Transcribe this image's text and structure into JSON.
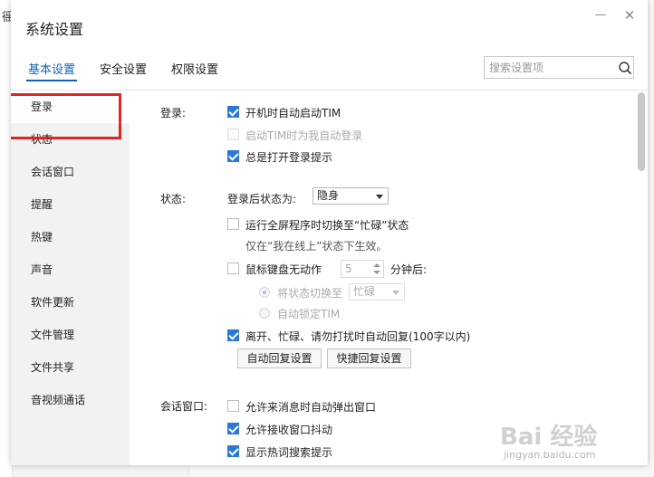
{
  "background": {
    "partial_char": "徭"
  },
  "window": {
    "title": "系统设置",
    "minimize": "—",
    "close": "✕"
  },
  "tabs": [
    {
      "label": "基本设置",
      "active": true
    },
    {
      "label": "安全设置",
      "active": false
    },
    {
      "label": "权限设置",
      "active": false
    }
  ],
  "search": {
    "placeholder": "搜索设置项",
    "value": ""
  },
  "sidebar": {
    "items": [
      {
        "label": "登录",
        "active": true
      },
      {
        "label": "状态",
        "active": false
      },
      {
        "label": "会话窗口",
        "active": false
      },
      {
        "label": "提醒",
        "active": false,
        "highlighted": true
      },
      {
        "label": "热键",
        "active": false
      },
      {
        "label": "声音",
        "active": false
      },
      {
        "label": "软件更新",
        "active": false
      },
      {
        "label": "文件管理",
        "active": false
      },
      {
        "label": "文件共享",
        "active": false
      },
      {
        "label": "音视频通话",
        "active": false
      }
    ]
  },
  "login": {
    "label": "登录:",
    "options": [
      {
        "text": "开机时自动启动TIM",
        "checked": true,
        "disabled": false
      },
      {
        "text": "启动TIM时为我自动登录",
        "checked": false,
        "disabled": true
      },
      {
        "text": "总是打开登录提示",
        "checked": true,
        "disabled": false
      }
    ]
  },
  "status": {
    "label": "状态:",
    "after_login_label": "登录后状态为:",
    "after_login_value": "隐身",
    "fullscreen_option": "运行全屏程序时切换至“忙碌”状态",
    "fullscreen_checked": false,
    "fullscreen_note": "仅在“我在线上”状态下生效。",
    "idle_option": "鼠标键盘无动作",
    "idle_checked": false,
    "idle_minutes": "5",
    "idle_suffix": "分钟后:",
    "switch_status_label": "将状态切换至",
    "switch_status_value": "忙碌",
    "auto_lock_label": "自动锁定TIM",
    "auto_reply_option": "离开、忙碌、请勿打扰时自动回复(100字以内)",
    "auto_reply_checked": true,
    "auto_reply_button": "自动回复设置",
    "quick_reply_button": "快捷回复设置"
  },
  "session": {
    "label": "会话窗口:",
    "options": [
      {
        "text": "允许来消息时自动弹出窗口",
        "checked": false,
        "disabled": false
      },
      {
        "text": "允许接收窗口抖动",
        "checked": true,
        "disabled": false
      },
      {
        "text": "显示热词搜索提示",
        "checked": true,
        "disabled": false
      }
    ]
  },
  "watermark": {
    "brand": "Bai 经验",
    "url": "jingyan.baidu.com"
  },
  "colors": {
    "accent": "#1263b5",
    "checkbox": "#2b79d6",
    "highlight": "#e02525",
    "sidebar_bg": "#f2f2f2"
  }
}
